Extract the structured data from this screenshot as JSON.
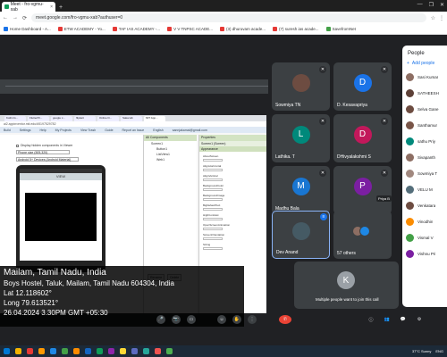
{
  "browser": {
    "tab_title": "Meet - fro-vgmu-xab",
    "close_glyph": "×",
    "new_tab_glyph": "+",
    "window_controls": [
      "—",
      "❐",
      "✕"
    ],
    "nav_icons": [
      "←",
      "→",
      "⟳"
    ],
    "url": "meet.google.com/fro-vgmu-xab?authuser=0",
    "right_icons": [
      "☆",
      "⋮"
    ],
    "bookmarks": [
      "Home Dashboard - A...",
      "ETW ACADEMY - Yo...",
      "TAF IAS ACADEMY -...",
      "V V TNPSC ACADE...",
      "(3) dhuruvam acade...",
      "(7) suresh ias acade...",
      "SavefromNet"
    ]
  },
  "shared_screen": {
    "tabs": [
      "Kotlin fo...",
      "Flutter/Fl...",
      "google c...",
      "flipkart",
      "Online D...",
      "Saka lab",
      "MIT App..."
    ],
    "url": "ai2.appinventor.mit.edu/#5197529782",
    "menu": [
      "Build",
      "Settings",
      "Help",
      "My Projects",
      "View Trash",
      "Guide",
      "Report an Issue",
      "English",
      "sannjakamal@gmail.com"
    ],
    "checkbox_label": "Display hidden components in Viewer",
    "phone_size_label": "Phone size (505,320)",
    "preview_select": "Android 5+ Devices (Android Material)",
    "phone_title": "VIEW",
    "components_header": "All Components",
    "components": [
      "Screen1",
      "Button1",
      "ListView1",
      "Web1"
    ],
    "component_buttons": [
      "Rename",
      "Delete"
    ],
    "properties_header": "Properties",
    "properties_sub": "Screen1 (Screen)",
    "properties_section": "Appearance",
    "properties": [
      "AboutScreen",
      "AlignHorizontal",
      "AlignVertical",
      "BackgroundColor",
      "BackgroundImage",
      "BigDefaultText",
      "HighContrast",
      "OpenScreenAnimation",
      "ScreenOrientation",
      "Sizing"
    ]
  },
  "geotag": {
    "place": "Mailam, Tamil Nadu, India",
    "address": "Boys Hostel, Taluk, Mailam, Tamil Nadu 604304, India",
    "lat": "Lat 12.118602°",
    "long": "Long 79.613521°",
    "datetime": "26.04.2024 3.30PM GMT +05:30"
  },
  "tiles": [
    {
      "name": "Sowmiya TN",
      "initial": "",
      "color": "#6d4c41",
      "muted": true
    },
    {
      "name": "D. Kesavapriya",
      "initial": "D",
      "color": "#1a73e8",
      "muted": true
    },
    {
      "name": "Lathika. T",
      "initial": "L",
      "color": "#00897b",
      "muted": true
    },
    {
      "name": "DHivyalakshmi S",
      "initial": "D",
      "color": "#c2185b",
      "muted": true
    },
    {
      "name": "Madhu Bala",
      "initial": "M",
      "color": "#1976d2",
      "muted": true
    },
    {
      "name": "",
      "initial": "P",
      "color": "#7b1fa2",
      "muted": true,
      "chip": "Priya B"
    },
    {
      "name": "Dev Anand",
      "initial": "",
      "color": "#455a64",
      "muted": false,
      "active": true
    },
    {
      "name": "57 others",
      "initial": "",
      "color": "",
      "muted": false
    }
  ],
  "join": {
    "initial": "K",
    "text": "Multiple people want to join this call"
  },
  "people_panel": {
    "title": "People",
    "add_label": "Add people",
    "members": [
      {
        "name": "Sasi Kumar",
        "color": "#8d6e63"
      },
      {
        "name": "SATHEESH",
        "color": "#5d4037"
      },
      {
        "name": "Selva Gane",
        "color": "#6d4c41"
      },
      {
        "name": "Santhamur",
        "color": "#795548"
      },
      {
        "name": "sathu Priy",
        "color": "#00897b"
      },
      {
        "name": "Sivapanth",
        "color": "#8d6e63"
      },
      {
        "name": "Sowmiya T",
        "color": "#a1887f"
      },
      {
        "name": "VELU M",
        "color": "#546e7a"
      },
      {
        "name": "Venkatara",
        "color": "#6d4c41"
      },
      {
        "name": "Vinodhin",
        "color": "#fb8c00"
      },
      {
        "name": "Vismal V",
        "color": "#43a047"
      },
      {
        "name": "Vishnu Pri",
        "color": "#7b1fa2"
      }
    ]
  },
  "controls": {
    "end_call_glyph": "✆",
    "buttons": [
      "🎤",
      "📷",
      "▭",
      "☺",
      "✋",
      "⋮"
    ],
    "right_icons": [
      "ⓘ",
      "👥",
      "💬",
      "⚙"
    ]
  },
  "taskbar": {
    "apps": [
      "#0078d4",
      "#f4b400",
      "#e53935",
      "#ff9800",
      "#1e88e5",
      "#43a047",
      "#fb8c00",
      "#1565c0",
      "#0f9d58",
      "#8e24aa",
      "#fdd835",
      "#5c6bc0",
      "#26a69a",
      "#ef5350",
      "#4caf50"
    ],
    "weather": "37°C Sunny",
    "lang": "ENG"
  }
}
